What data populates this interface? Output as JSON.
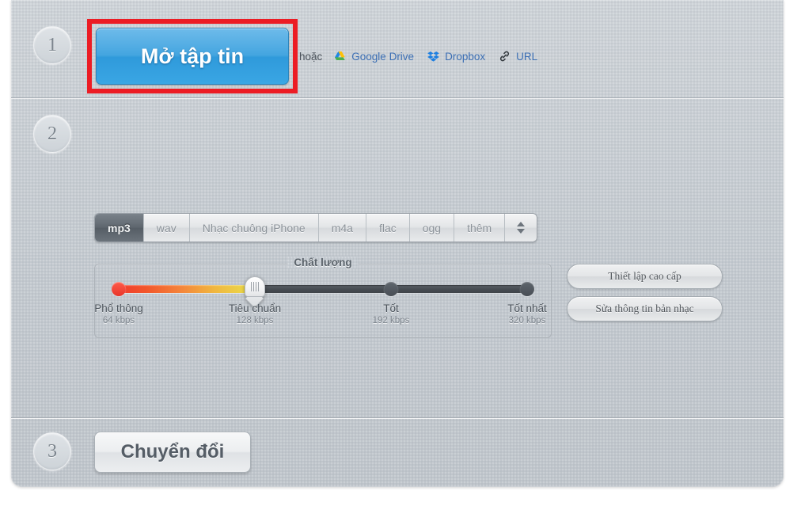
{
  "steps": {
    "one": "1",
    "two": "2",
    "three": "3"
  },
  "step1": {
    "open_file_label": "Mở tập tin",
    "or_label": "hoặc",
    "sources": [
      {
        "label": "Google Drive",
        "icon": "google-drive-icon"
      },
      {
        "label": "Dropbox",
        "icon": "dropbox-icon"
      },
      {
        "label": "URL",
        "icon": "link-icon"
      }
    ]
  },
  "step2": {
    "formats": [
      {
        "label": "mp3",
        "active": true
      },
      {
        "label": "wav",
        "active": false
      },
      {
        "label": "Nhạc chuông iPhone",
        "active": false
      },
      {
        "label": "m4a",
        "active": false
      },
      {
        "label": "flac",
        "active": false
      },
      {
        "label": "ogg",
        "active": false
      },
      {
        "label": "thêm",
        "active": false
      }
    ],
    "stepper_icon": "up-down-arrows-icon",
    "quality": {
      "legend": "Chất lượng",
      "selected_index": 1,
      "stops": [
        {
          "name": "Phổ thông",
          "rate": "64 kbps"
        },
        {
          "name": "Tiêu chuẩn",
          "rate": "128 kbps"
        },
        {
          "name": "Tốt",
          "rate": "192 kbps"
        },
        {
          "name": "Tốt nhất",
          "rate": "320 kbps"
        }
      ]
    },
    "advanced_label": "Thiết lập cao cấp",
    "edit_tags_label": "Sửa thông tin bản nhạc"
  },
  "step3": {
    "convert_label": "Chuyển đổi"
  },
  "colors": {
    "accent_blue": "#3aa6e4",
    "highlight_red": "#ec1c24",
    "panel_gray": "#c6ccd2",
    "link_blue": "#3c6fb4"
  }
}
